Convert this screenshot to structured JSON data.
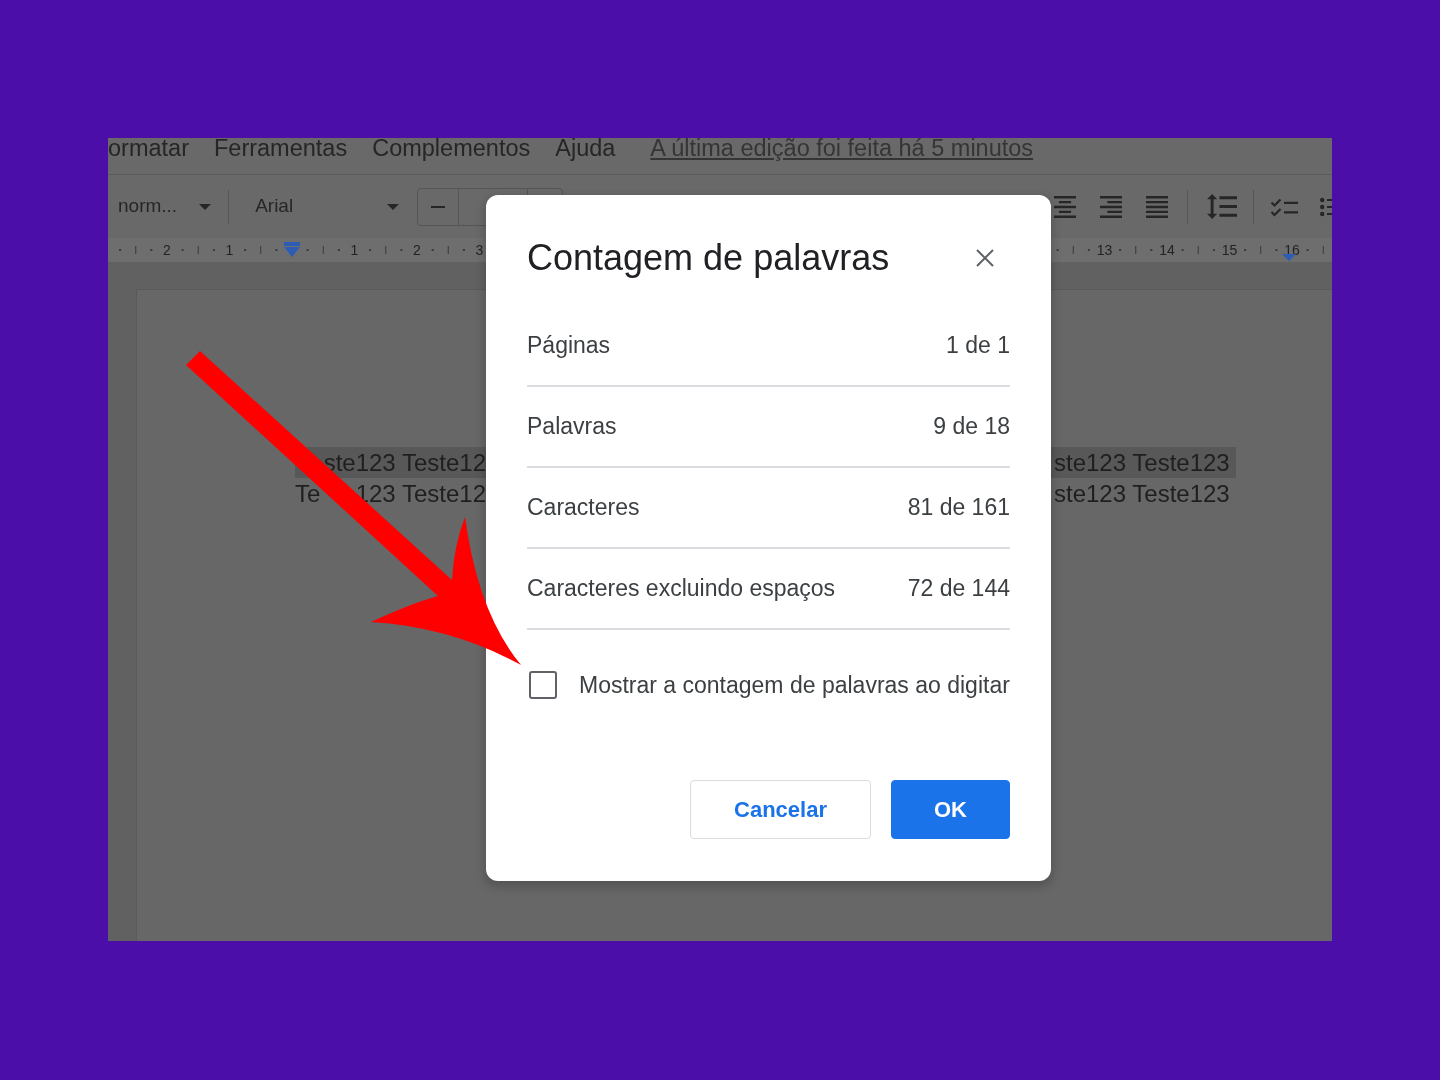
{
  "menu_bar": {
    "items": [
      "ormatar",
      "Ferramentas",
      "Complementos",
      "Ajuda"
    ],
    "last_edit": "A última edição foi feita há 5 minutos"
  },
  "toolbar": {
    "paragraph_style": "norm...",
    "font": "Arial"
  },
  "ruler": {
    "before_indent": [
      "2",
      "1"
    ],
    "after_indent": [
      "1",
      "2",
      "3"
    ],
    "near_right_indent": [
      "13",
      "14",
      "15",
      "16"
    ]
  },
  "document": {
    "lines": [
      {
        "selected": true,
        "left": [
          "ste123 Teste12"
        ],
        "right": "ste123 Teste123"
      },
      {
        "selected": false,
        "left": [
          "Te",
          "123 Teste12"
        ],
        "right": "ste123 Teste123"
      }
    ]
  },
  "dialog": {
    "title": "Contagem de palavras",
    "stats": [
      {
        "label": "Páginas",
        "value": "1 de 1"
      },
      {
        "label": "Palavras",
        "value": "9 de 18"
      },
      {
        "label": "Caracteres",
        "value": "81 de 161"
      },
      {
        "label": "Caracteres excluindo espaços",
        "value": "72 de 144"
      }
    ],
    "option": {
      "label": "Mostrar a contagem de palavras ao digitar",
      "checked": false
    },
    "buttons": [
      {
        "label": "Cancelar",
        "kind": "secondary"
      },
      {
        "label": "OK",
        "kind": "primary"
      }
    ]
  }
}
